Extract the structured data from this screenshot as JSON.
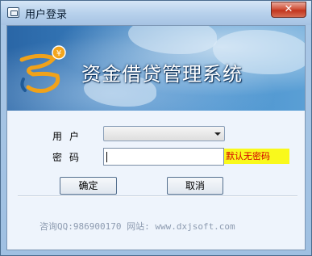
{
  "window": {
    "title": "用户登录",
    "close_label": "✕"
  },
  "banner": {
    "app_name": "资金借贷管理系统"
  },
  "form": {
    "user_label": "用户",
    "user_value": "",
    "password_label": "密码",
    "password_value": "",
    "password_hint": "默认无密码"
  },
  "buttons": {
    "ok_label": "确定",
    "cancel_label": "取消"
  },
  "footer": {
    "contact": "咨询QQ:986900170  网站: www.dxjsoft.com"
  },
  "colors": {
    "hint_background": "#f9f91c",
    "hint_text": "#d40000",
    "close_button": "#c2351e"
  }
}
